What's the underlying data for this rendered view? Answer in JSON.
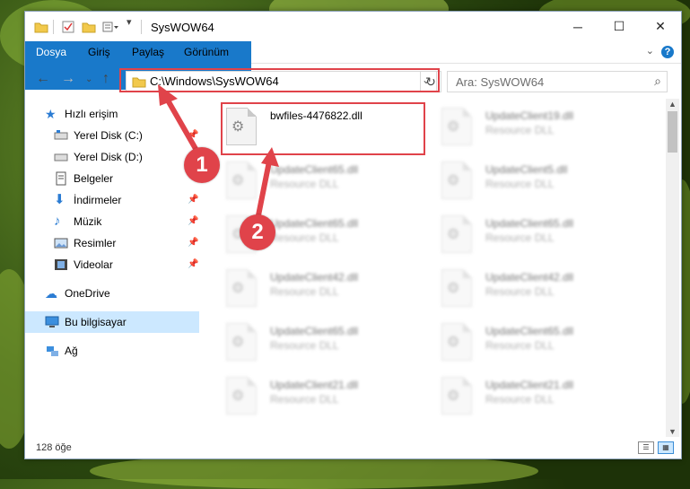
{
  "window": {
    "title": "SysWOW64"
  },
  "ribbon": {
    "tabs": [
      "Dosya",
      "Giriş",
      "Paylaş",
      "Görünüm"
    ]
  },
  "address": {
    "path": "C:\\Windows\\SysWOW64"
  },
  "search": {
    "placeholder": "Ara: SysWOW64"
  },
  "sidebar": {
    "items": [
      {
        "label": "Hızlı erişim"
      },
      {
        "label": "Yerel Disk (C:)"
      },
      {
        "label": "Yerel Disk (D:)"
      },
      {
        "label": "Belgeler"
      },
      {
        "label": "İndirmeler"
      },
      {
        "label": "Müzik"
      },
      {
        "label": "Resimler"
      },
      {
        "label": "Videolar"
      },
      {
        "label": "OneDrive"
      },
      {
        "label": "Bu bilgisayar"
      },
      {
        "label": "Ağ"
      }
    ]
  },
  "files": [
    {
      "name": "bwfiles-4476822.dll",
      "type": ""
    },
    {
      "name": "UpdateClient19.dll",
      "type": "Resource DLL"
    },
    {
      "name": "UpdateClient65.dll",
      "type": "Resource DLL"
    },
    {
      "name": "UpdateClient5.dll",
      "type": "Resource DLL"
    },
    {
      "name": "UpdateClient65.dll",
      "type": "Resource DLL"
    },
    {
      "name": "UpdateClient65.dll",
      "type": "Resource DLL"
    },
    {
      "name": "UpdateClient42.dll",
      "type": "Resource DLL"
    },
    {
      "name": "UpdateClient42.dll",
      "type": "Resource DLL"
    },
    {
      "name": "UpdateClient65.dll",
      "type": "Resource DLL"
    },
    {
      "name": "UpdateClient65.dll",
      "type": "Resource DLL"
    },
    {
      "name": "UpdateClient21.dll",
      "type": "Resource DLL"
    },
    {
      "name": "UpdateClient21.dll",
      "type": "Resource DLL"
    }
  ],
  "status": {
    "count": "128 öğe"
  },
  "callouts": [
    "1",
    "2"
  ],
  "colors": {
    "accent": "#1979ca",
    "highlight": "#e0434a",
    "selected": "#cce8ff"
  }
}
